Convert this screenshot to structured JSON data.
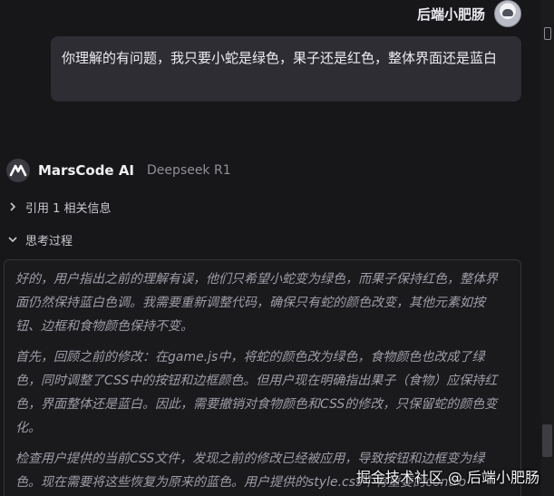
{
  "user": {
    "name": "后端小肥肠",
    "message": "你理解的有问题，我只要小蛇是绿色，果子还是红色，整体界面还是蓝白"
  },
  "assistant": {
    "name": "MarsCode AI",
    "model": "Deepseek R1",
    "reference_label": "引用 1 相关信息",
    "thinking_label": "思考过程",
    "thinking_paragraphs": [
      "好的，用户指出之前的理解有误，他们只希望小蛇变为绿色，而果子保持红色，整体界面仍然保持蓝白色调。我需要重新调整代码，确保只有蛇的颜色改变，其他元素如按钮、边框和食物颜色保持不变。",
      "首先，回顾之前的修改：在game.js中，将蛇的颜色改为绿色，食物颜色也改成了绿色，同时调整了CSS中的按钮和边框颜色。但用户现在明确指出果子（食物）应保持红色，界面整体还是蓝白。因此，需要撤销对食物颜色和CSS的修改，只保留蛇的颜色变化。",
      "检查用户提供的当前CSS文件，发现之前的修改已经被应用，导致按钮和边框变为绿色。现在需要将这些恢复为原来的蓝色。用户提供的style.css中有重要的contro"
    ]
  },
  "watermark": "掘金技术社区 @ 后端小肥肠",
  "colors": {
    "background": "#17171a",
    "bubble": "#2d2d33",
    "thinking_text": "#9d9da6"
  }
}
